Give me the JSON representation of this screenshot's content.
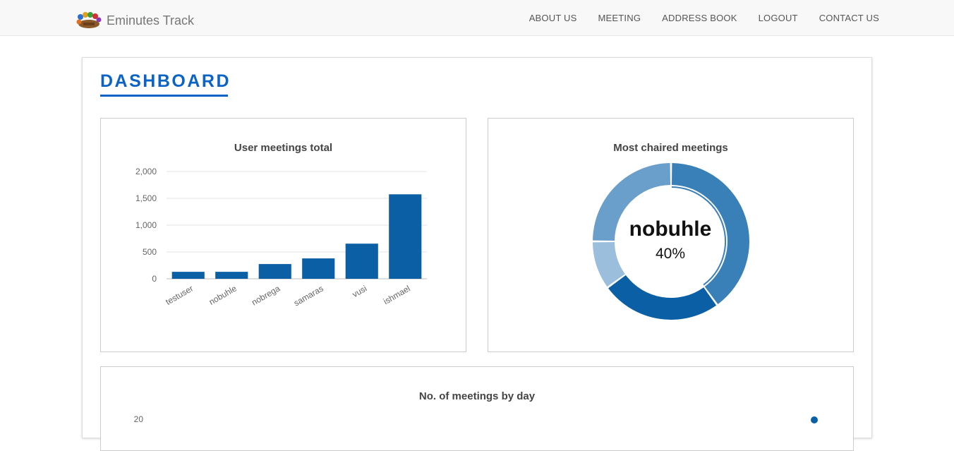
{
  "navbar": {
    "brand": "Eminutes Track",
    "logo_icon": "meeting-people-logo",
    "links": [
      "ABOUT US",
      "MEETING",
      "ADDRESS BOOK",
      "LOGOUT",
      "CONTACT US"
    ]
  },
  "dashboard": {
    "title": "DASHBOARD"
  },
  "colors": {
    "accent": "#0a63c5",
    "bar": "#0b5fa5"
  },
  "chart_data": [
    {
      "type": "bar",
      "title": "User meetings total",
      "categories": [
        "testuser",
        "nobuhle",
        "nobrega",
        "samaras",
        "vusi",
        "ishmael"
      ],
      "values": [
        130,
        130,
        275,
        380,
        655,
        1575
      ],
      "ylim": [
        0,
        2000
      ],
      "yticks": [
        0,
        500,
        1000,
        1500,
        2000
      ],
      "ytick_labels": [
        "0",
        "500",
        "1,000",
        "1,500",
        "2,000"
      ],
      "grid": true
    },
    {
      "type": "pie",
      "title": "Most chaired meetings",
      "center_label": "nobuhle",
      "center_value": "40%",
      "slices": [
        {
          "value": 40,
          "color": "#3a80b8"
        },
        {
          "value": 25,
          "color": "#0b5fa5"
        },
        {
          "value": 10,
          "color": "#9abedb"
        },
        {
          "value": 25,
          "color": "#6a9fcb"
        }
      ]
    },
    {
      "type": "line",
      "title": "No. of meetings by day",
      "ytick_labels": [
        "20"
      ]
    }
  ]
}
